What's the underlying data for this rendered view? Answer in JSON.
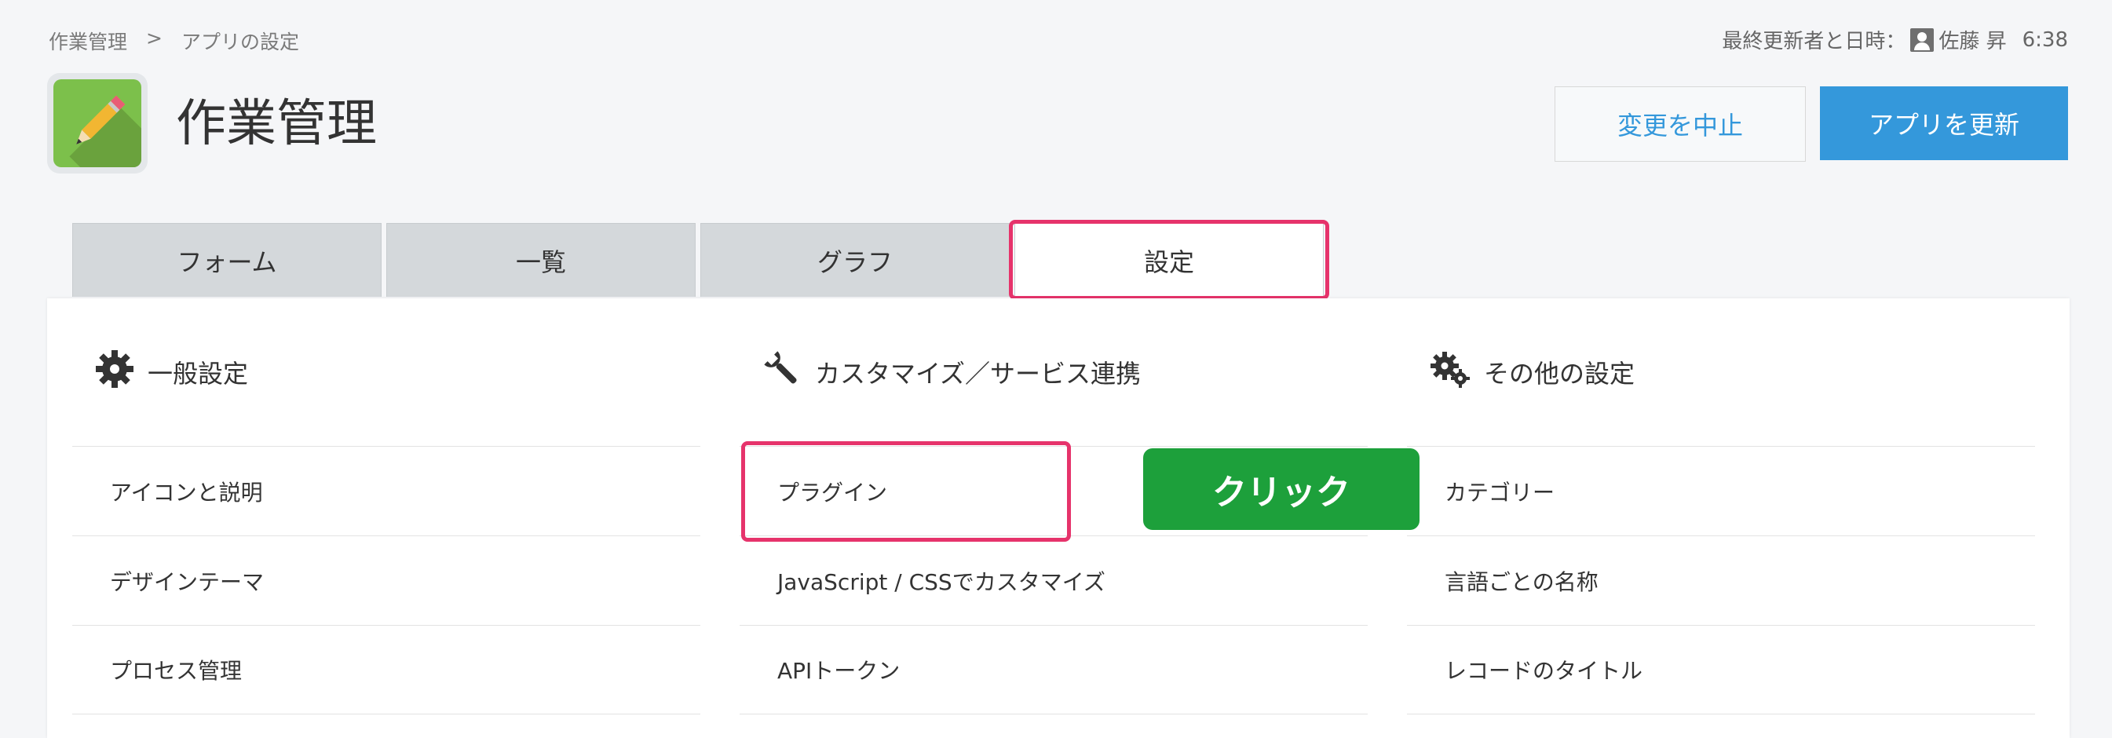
{
  "breadcrumb": {
    "app": "作業管理",
    "separator": ">",
    "current": "アプリの設定"
  },
  "meta": {
    "label": "最終更新者と日時：",
    "user": "佐藤 昇",
    "time": "6:38"
  },
  "app": {
    "title": "作業管理",
    "icon": "pencil-icon"
  },
  "actions": {
    "cancel_label": "変更を中止",
    "update_label": "アプリを更新"
  },
  "tabs": [
    {
      "label": "フォーム"
    },
    {
      "label": "一覧"
    },
    {
      "label": "グラフ"
    },
    {
      "label": "設定",
      "active": true
    }
  ],
  "sections": [
    {
      "title": "一般設定",
      "icon": "gear-icon",
      "items": [
        "アイコンと説明",
        "デザインテーマ",
        "プロセス管理"
      ]
    },
    {
      "title": "カスタマイズ／サービス連携",
      "icon": "wrench-icon",
      "items": [
        "プラグイン",
        "JavaScript / CSSでカスタマイズ",
        "APIトークン"
      ]
    },
    {
      "title": "その他の設定",
      "icon": "gears-icon",
      "items": [
        "カテゴリー",
        "言語ごとの名称",
        "レコードのタイトル"
      ]
    }
  ],
  "annotation": {
    "callout_label": "クリック"
  },
  "colors": {
    "primary": "#3498db",
    "highlight": "#e6336b",
    "callout": "#1da03b",
    "app_icon": "#7cc04b"
  }
}
